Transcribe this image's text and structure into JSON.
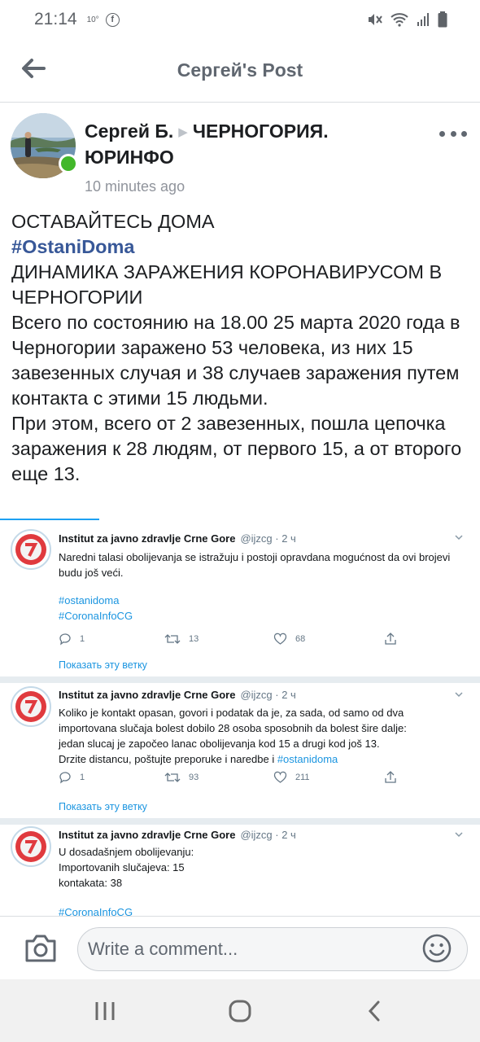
{
  "status_bar": {
    "time": "21:14",
    "temperature": "10°",
    "icons": [
      "facebook-icon",
      "mute-icon",
      "wifi-icon",
      "signal-icon",
      "battery-icon"
    ]
  },
  "header": {
    "title": "Сергей's Post",
    "back_icon": "arrow-left-icon"
  },
  "post": {
    "author": "Сергей Б.",
    "target": "ЧЕРНОГОРИЯ. ЮРИНФО",
    "timestamp": "10 minutes ago",
    "more_icon": "more-horizontal-icon",
    "lines": [
      "ОСТАВАЙТЕСЬ ДОМА",
      "#OstaniDoma",
      "ДИНАМИКА ЗАРАЖЕНИЯ КОРОНАВИРУСОМ В ЧЕРНОГОРИИ",
      "Всего по состоянию на 18.00 25 марта 2020 года в Черногории заражено 53 человека, из них 15 завезенных случая и 38 случаев заражения путем контакта с этими 15 людьми.",
      "При этом, всего от 2 завезенных, пошла цепочка заражения к 28 людям, от первого 15, а от второго еще 13."
    ]
  },
  "embed": {
    "tweets": [
      {
        "name": "Institut za javno zdravlje Crne Gore",
        "handle": "@ijzcg · 2 ч",
        "text": "Naredni talasi obolijevanja se istražuju i postoji opravdana mogućnost da ovi brojevi budu još veći.",
        "tags": [
          "#ostanidoma",
          "#CoronaInfoCG"
        ],
        "replies": "1",
        "retweets": "13",
        "likes": "68",
        "thread_label": "Показать эту ветку"
      },
      {
        "name": "Institut za javno zdravlje Crne Gore",
        "handle": "@ijzcg · 2 ч",
        "text_lines": [
          "Koliko je kontakt opasan, govori i podatak da je, za sada, od samo od dva",
          "importovana slučaja bolest dobilo 28 osoba sposobnih da bolest šire dalje:",
          "jedan slucaj je započeo lanac obolijevanja kod 15 a drugi kod još 13.",
          "Drzite distancu, poštujte  preporuke i naredbe i "
        ],
        "tag": "#ostanidoma",
        "replies": "1",
        "retweets": "93",
        "likes": "211",
        "thread_label": "Показать эту ветку"
      },
      {
        "name": "Institut za javno zdravlje Crne Gore",
        "handle": "@ijzcg · 2 ч",
        "text_lines": [
          "U dosadašnjem obolijevanju:",
          "Importovanih slučajeva: 15",
          "kontakata: 38"
        ],
        "tag": "#CoronaInfoCG"
      }
    ]
  },
  "comment_bar": {
    "placeholder": "Write a comment...",
    "camera_icon": "camera-icon",
    "emoji_icon": "emoji-icon"
  },
  "nav_bar": {
    "icons": [
      "recent-apps-icon",
      "home-icon",
      "back-icon"
    ]
  },
  "colors": {
    "online": "#42b72a",
    "hashtag": "#385898",
    "twitter_link": "#1b95e0",
    "accent_red": "#e03a3e"
  }
}
